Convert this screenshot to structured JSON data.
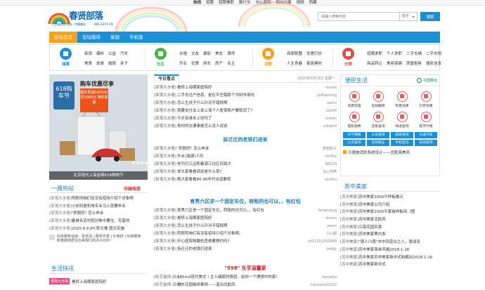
{
  "toplinks": [
    "热线",
    "招聘",
    "招聘兼职",
    "数行车",
    "中心医院",
    "阳光问事",
    "视频",
    "西藏"
  ],
  "logo": {
    "title": "春贤部落",
    "sub": "打造服务苏北网，传播美好！",
    "url": "BBS.SZYX.CN"
  },
  "search": {
    "placeholder": "请输入搜索内容",
    "option": "帖子",
    "button": "搜索"
  },
  "nav": [
    "论坛首页",
    "论坛版块",
    "家园",
    "手机版"
  ],
  "cats": [
    {
      "label": "城事",
      "color": "#1a90d9",
      "links": [
        "新闻",
        "爆料",
        "公益",
        "汽车",
        "美食",
        "旅游",
        "婚嫁",
        "亲子"
      ]
    },
    {
      "label": "社区",
      "color": "#4bb34b",
      "links": [
        "水墙",
        "交友",
        "摄影",
        "美女",
        "律师",
        "开业",
        "优惠",
        "拼车",
        "房产",
        "业主"
      ]
    },
    {
      "label": "消费",
      "color": "#f7a11b",
      "links": [
        "商家联盟",
        "优惠打折",
        "人生青春",
        "家居建材"
      ]
    },
    {
      "label": "分类",
      "color": "#e14d4d",
      "links": [
        "招聘求职",
        "个人求职",
        "二手车辆",
        "二手市场",
        "商品转让",
        "美容保健",
        "房屋租售",
        "便民信息"
      ]
    }
  ],
  "banner": {
    "slogan": "购车优惠尽享",
    "badge": "618购车节",
    "tag": "额外再减5000元/至1000元 等你来赢",
    "caption": "北京现代上海金顿618购物节"
  },
  "yizhou": {
    "title": "一周热帖",
    "more": "中国电信",
    "items": [
      {
        "tag": "[部落大水墙]",
        "text": "阿郎你咱们有没有招待介绍个对象啊"
      },
      {
        "tag": "[部落大水墙]",
        "text": "小孩劝退机电专业马上就要毕业"
      },
      {
        "tag": "[部落大水墙]",
        "text": "\"抓脱药\" 怎么申诉"
      },
      {
        "tag": "[部落大水墙]",
        "text": "春城名农村招对象中要住、宅基地"
      },
      {
        "tag": "[部落大水墙]",
        "text": "2020.6.9 JPC转大楼 图文实施"
      }
    ],
    "ad1": "好房聚焦话速：逐渐深 | 服务优惠 | 价格低 | 好房聚焦",
    "ad2": "新春期待居住出来我们的点子对外!"
  },
  "shenghuo": {
    "title": "生活快讯",
    "tag": "部落大水墙",
    "text": "看转上海哪家医院好"
  },
  "today": {
    "tab": "今日看点",
    "date": "2020年6月15日 星期一",
    "rows": [
      {
        "tag": "[部落大水墙]",
        "title": "看转上海哪家医院好",
        "au": "nissan"
      },
      {
        "tag": "[部落大水墙]",
        "title": "二手车过户信息，是在平庄路那个邻封市场吗",
        "au": "yellowming"
      },
      {
        "tag": "[部落大水墙]",
        "title": "怎么生孩子什么针对不错挑啊",
        "au": "zearv"
      },
      {
        "tag": "[部落大水墙]",
        "title": "我要支付业上说上海个人医保账户要取消了?",
        "au": "zzzz4f"
      },
      {
        "tag": "[部落大水墙]",
        "title": "今天有谁去上班吗了",
        "au": "nissan"
      },
      {
        "tag": "[部落大水墙]",
        "title": "青村的交通事故怎么没人说说",
        "au": "aibojrof"
      }
    ]
  },
  "headline1": "拆迁迁的老铁们进来",
  "rows2": [
    {
      "tag": "[部落大水墙]",
      "title": "\"抓脱药\" 怎么申诉",
      "au": "梦如影子"
    },
    {
      "tag": "[部落大水墙]",
      "title": "东乡(瑞湖)人吗",
      "au": "smithy"
    },
    {
      "tag": "[部落大水墙]",
      "title": "老司们江边和春源江边区到真大",
      "au": "B8233"
    },
    {
      "tag": "[部落大水墙]",
      "title": "求大家看看调这是什么草?",
      "au": "关心你啊"
    },
    {
      "tag": "[部落大水墙]",
      "title": "晚大家看看80-90年代出道删呢",
      "au": "smithu"
    }
  ],
  "headline2": "育秀六区求一个固定车位，转租的也可以，，有红包",
  "rows3": [
    {
      "tag": "[部落大水墙]",
      "title": "育秀六区求一个固定车位，转租的也可以，，有红包",
      "au": "fengkuang"
    },
    {
      "tag": "[部落大水墙]",
      "title": "看转上海哪家医院好",
      "au": "nissan"
    },
    {
      "tag": "[部落大水墙]",
      "title": "怎么生孩子什么针对不错挑啊",
      "au": "zearv"
    },
    {
      "tag": "[部落大水墙]",
      "title": "阿郎阿咱们有没有招待介绍个对象啊。",
      "au": "小心期"
    },
    {
      "tag": "[部落大水墙]",
      "title": "中心医院核酸检查费要预约吗?",
      "au": "wf11201352999"
    },
    {
      "tag": "[部落大水墙]",
      "title": "拆迁迁的老铁们进来",
      "au": "tmdly"
    }
  ],
  "ad598": {
    "num": "\"598\"",
    "text": "东亨温馨家"
  },
  "rows4": [
    {
      "tag": "[砂艺装饰-设计]",
      "title": "145m2现代美式丨主人细腻的情感，给你一个理想中的家!",
      "au": "hanseliz"
    },
    {
      "tag": "[砂艺装饰-设计]",
      "title": "恒东花园装修案例——温泊北欧风",
      "au": "hanxiaoyi2020"
    }
  ],
  "life": {
    "title": "便民生活",
    "mobile": "中国移动",
    "items": [
      "话费充值",
      "在线翻译",
      "积累兑换",
      "打折优惠",
      "电影放映",
      "违章查询",
      "快递查询",
      "股市行情"
    ],
    "buttons": [
      "天气预报",
      "火车查询",
      "航班查询",
      "长途汽车",
      "公交查询",
      "在线留言",
      "手机定位",
      "在线查询"
    ],
    "notice": "贝德施消防系统设计——优胜简美风"
  },
  "suzhong": {
    "title": "苏中美家",
    "items": [
      {
        "tag": "[苏中美家]",
        "text": "苏中美家1000平样板展示"
      },
      {
        "tag": "[苏中美家]",
        "text": "苏中美家公司介绍"
      },
      {
        "tag": "[苏中美家]",
        "text": "苏中美家1000平家装样板间（图"
      },
      {
        "tag": "[苏中美家]",
        "text": "苏中美家北欧风"
      },
      {
        "tag": "[苏中美家]",
        "text": "江南花园实景"
      },
      {
        "tag": "[苏中美家]",
        "text": "苏中美家黑白系"
      },
      {
        "tag": "[苏中美家]",
        "text": "\"尊人川尊\"市中同道合之人，尊阔忠"
      },
      {
        "tag": "[苏中美家]",
        "text": "苏中美家简单风格2018.1.16"
      },
      {
        "tag": "[苏中美家]",
        "text": "苏中美家苏中美家新中式新解出2018.1.16"
      },
      {
        "tag": "[苏中美家]",
        "text": "苏中美家新中式"
      }
    ]
  }
}
